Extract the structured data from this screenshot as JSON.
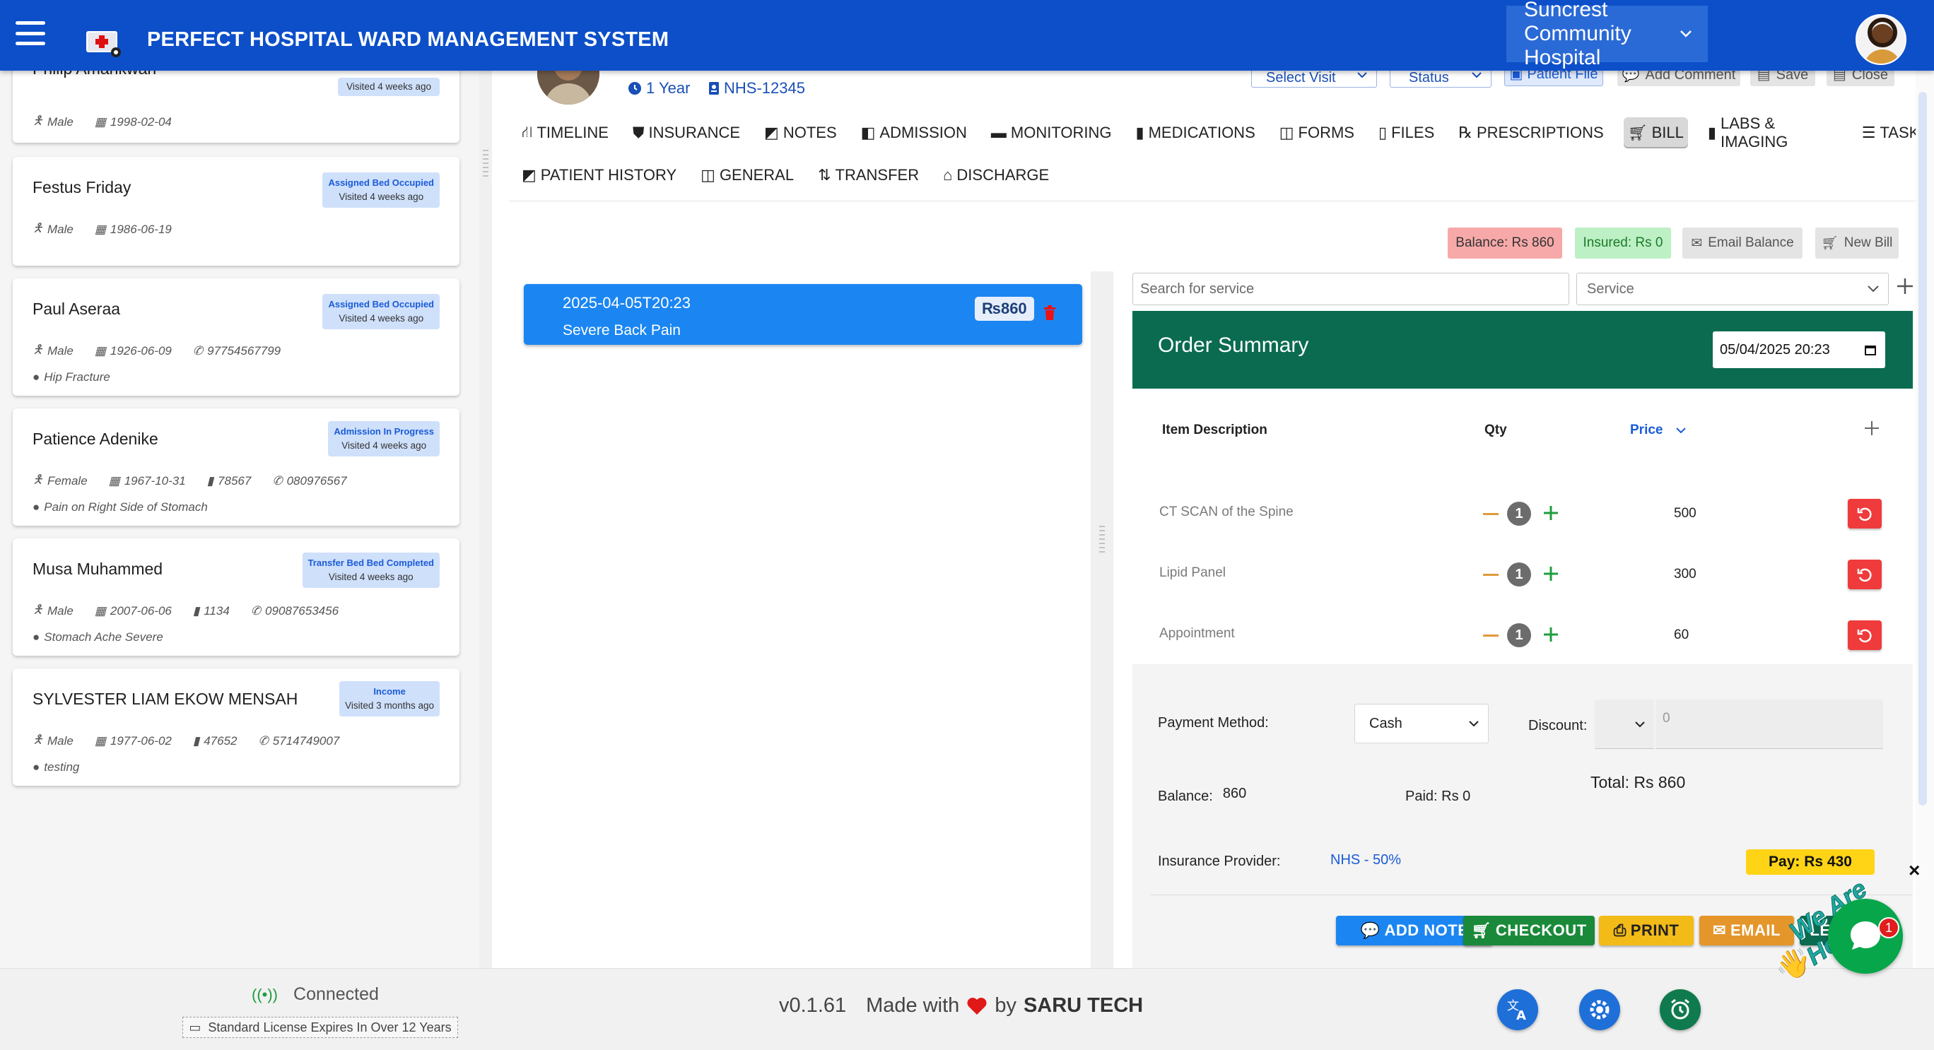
{
  "app": {
    "title": "PERFECT HOSPITAL WARD MANAGEMENT SYSTEM",
    "hospital": "Suncrest Community Hospital"
  },
  "patients": [
    {
      "name": "Philip Amankwah",
      "badge_status": "",
      "badge_visit": "Visited 4 weeks ago",
      "gender": "Male",
      "dob": "1998-02-04",
      "id": "",
      "phone": "",
      "diagnosis": ""
    },
    {
      "name": "Festus Friday",
      "badge_status": "Assigned Bed Occupied",
      "badge_visit": "Visited 4 weeks ago",
      "gender": "Male",
      "dob": "1986-06-19",
      "id": "",
      "phone": "",
      "diagnosis": ""
    },
    {
      "name": "Paul Aseraa",
      "badge_status": "Assigned Bed Occupied",
      "badge_visit": "Visited 4 weeks ago",
      "gender": "Male",
      "dob": "1926-06-09",
      "id": "",
      "phone": "97754567799",
      "diagnosis": "Hip Fracture"
    },
    {
      "name": "Patience Adenike",
      "badge_status": "Admission In Progress",
      "badge_visit": "Visited 4 weeks ago",
      "gender": "Female",
      "dob": "1967-10-31",
      "id": "78567",
      "phone": "080976567",
      "diagnosis": "Pain on Right Side of Stomach"
    },
    {
      "name": "Musa Muhammed",
      "badge_status": "Transfer Bed Bed Completed",
      "badge_visit": "Visited 4 weeks ago",
      "gender": "Male",
      "dob": "2007-06-06",
      "id": "1134",
      "phone": "09087653456",
      "diagnosis": "Stomach Ache Severe"
    },
    {
      "name": "SYLVESTER LIAM EKOW MENSAH",
      "badge_status": "Income",
      "badge_visit": "Visited 3 months ago",
      "gender": "Male",
      "dob": "1977-06-02",
      "id": "47652",
      "phone": "5714749007",
      "diagnosis": "testing"
    }
  ],
  "patient_header": {
    "age": "1 Year",
    "nhs": "NHS-12345",
    "select_visit": "Select Visit",
    "status": "Status",
    "patient_file": "Patient File",
    "add_comment": "Add Comment",
    "save": "Save",
    "close": "Close"
  },
  "tabs": {
    "row1": [
      "TIMELINE",
      "INSURANCE",
      "NOTES",
      "ADMISSION",
      "MONITORING",
      "MEDICATIONS",
      "FORMS",
      "FILES",
      "PRESCRIPTIONS",
      "BILL",
      "LABS & IMAGING",
      "TASKS"
    ],
    "row2": [
      "PATIENT HISTORY",
      "GENERAL",
      "TRANSFER",
      "DISCHARGE"
    ],
    "active": "BILL"
  },
  "bill": {
    "balance_chip": "Balance: Rs 860",
    "insured_chip": "Insured: Rs 0",
    "email_balance": "Email Balance",
    "new_bill": "New Bill",
    "visit": {
      "date": "2025-04-05T20:23",
      "title": "Severe Back Pain",
      "amount": "₨860"
    },
    "search_placeholder": "Search for service",
    "service_placeholder": "Service"
  },
  "order": {
    "title": "Order Summary",
    "date": "05/04/2025 20:23",
    "headers": {
      "desc": "Item Description",
      "qty": "Qty",
      "price": "Price"
    },
    "items": [
      {
        "desc": "CT SCAN of the Spine",
        "qty": "1",
        "price": "500"
      },
      {
        "desc": "Lipid Panel",
        "qty": "1",
        "price": "300"
      },
      {
        "desc": "Appointment",
        "qty": "1",
        "price": "60"
      }
    ],
    "payment_method_label": "Payment Method:",
    "payment_method": "Cash",
    "discount_label": "Discount:",
    "discount_value": "0",
    "balance_label": "Balance:",
    "balance_value": "860",
    "paid": "Paid: Rs 0",
    "total": "Total: Rs 860",
    "insurance_label": "Insurance Provider:",
    "insurance_value": "NHS - 50%",
    "pay": "Pay: Rs 430"
  },
  "actions": {
    "add_note": "ADD NOTE",
    "checkout": "CHECKOUT",
    "print": "PRINT",
    "email": "EMAIL",
    "more": "LE"
  },
  "footer": {
    "connection": "Connected",
    "license": "Standard License Expires In Over 12 Years",
    "version": "v0.1.61",
    "made_with": "Made with",
    "by": "by",
    "company": "SARU TECH"
  },
  "chat": {
    "banner": "We Are Here!",
    "badge": "1",
    "close": "×"
  },
  "colors": {
    "topbar": "#0c4fc9",
    "order_header": "#0a6b50",
    "visit_card": "#1b86f2",
    "delete": "#ef3b3b"
  }
}
